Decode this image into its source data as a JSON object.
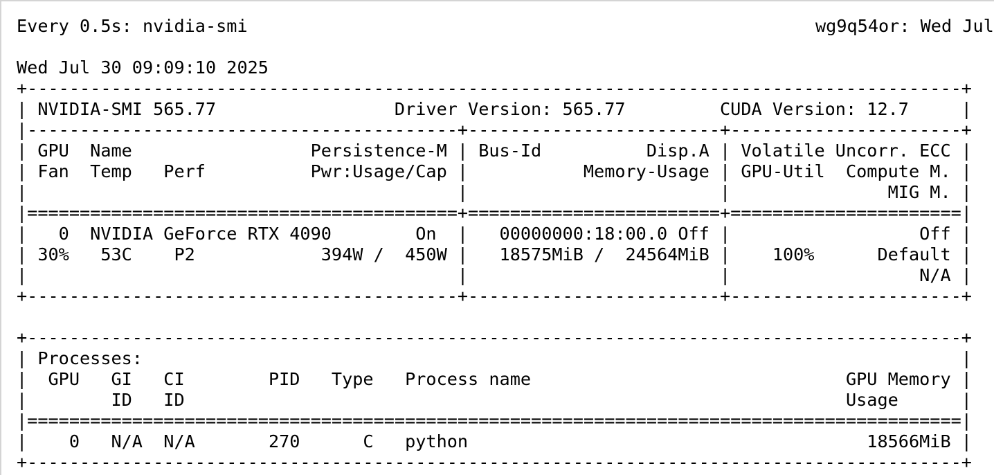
{
  "watch_header": {
    "command": "Every 0.5s: nvidia-smi",
    "host_time": "wg9q54or: Wed Jul"
  },
  "terminal_lines": [
    "",
    "Wed Jul 30 09:09:10 2025",
    "+-----------------------------------------------------------------------------------------+",
    "| NVIDIA-SMI 565.77                 Driver Version: 565.77         CUDA Version: 12.7     |",
    "|-----------------------------------------+------------------------+----------------------+",
    "| GPU  Name                 Persistence-M | Bus-Id          Disp.A | Volatile Uncorr. ECC |",
    "| Fan  Temp   Perf          Pwr:Usage/Cap |           Memory-Usage | GPU-Util  Compute M. |",
    "|                                         |                        |               MIG M. |",
    "|=========================================+========================+======================|",
    "|   0  NVIDIA GeForce RTX 4090        On  |   00000000:18:00.0 Off |                  Off |",
    "| 30%   53C    P2            394W /  450W |   18575MiB /  24564MiB |    100%      Default |",
    "|                                         |                        |                  N/A |",
    "+-----------------------------------------+------------------------+----------------------+",
    "",
    "+-----------------------------------------------------------------------------------------+",
    "| Processes:                                                                              |",
    "|  GPU   GI   CI        PID   Type   Process name                              GPU Memory |",
    "|        ID   ID                                                               Usage      |",
    "|=========================================================================================|",
    "|    0   N/A  N/A       270      C   python                                      18566MiB |",
    "+-----------------------------------------------------------------------------------------+"
  ]
}
